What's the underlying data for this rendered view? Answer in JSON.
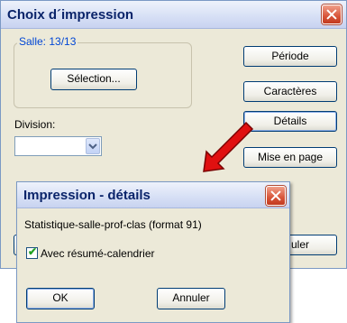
{
  "main_window": {
    "title": "Choix d´impression",
    "salle_group_label": "Salle: 13/13",
    "selection_button": "Sélection...",
    "division_label": "Division:",
    "division_value": "",
    "periode_button": "Période",
    "caracteres_button": "Caractères",
    "details_button": "Détails",
    "mise_en_page_button": "Mise en page",
    "annuler_button_partial": "uler"
  },
  "details_dialog": {
    "title": "Impression - détails",
    "format_text": "Statistique-salle-prof-clas (format 91)",
    "checkbox_label": "Avec résumé-calendrier",
    "checkbox_checked": true,
    "ok_button": "OK",
    "cancel_button": "Annuler"
  },
  "colors": {
    "title_text": "#0a246a",
    "group_label": "#0046d5",
    "arrow": "#e01010"
  }
}
